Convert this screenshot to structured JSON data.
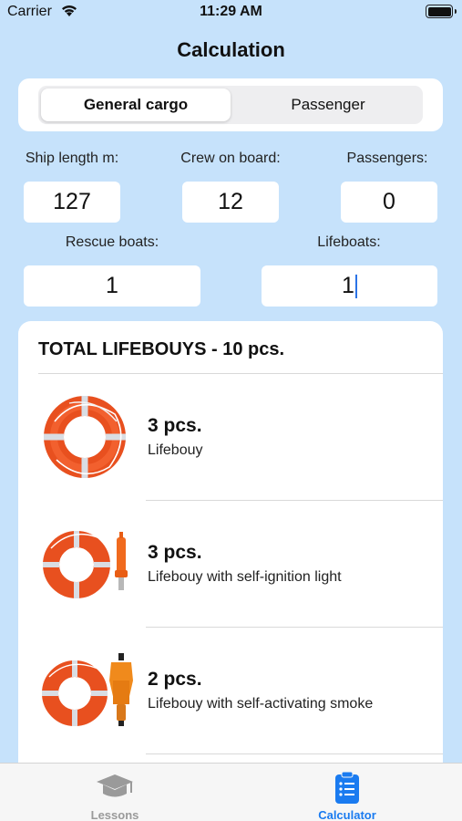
{
  "status_bar": {
    "carrier": "Carrier",
    "time": "11:29 AM"
  },
  "title": "Calculation",
  "segments": [
    {
      "label": "General cargo",
      "selected": true
    },
    {
      "label": "Passenger",
      "selected": false
    }
  ],
  "fields": {
    "ship_length": {
      "label": "Ship length m:",
      "value": "127"
    },
    "crew": {
      "label": "Crew on board:",
      "value": "12"
    },
    "passengers": {
      "label": "Passengers:",
      "value": "0"
    },
    "rescue_boats": {
      "label": "Rescue boats:",
      "value": "1"
    },
    "lifeboats": {
      "label": "Lifeboats:",
      "value": "1"
    }
  },
  "results": {
    "title": "TOTAL LIFEBOUYS - 10 pcs.",
    "items": [
      {
        "qty": "3 pcs.",
        "desc": "Lifebouy",
        "icon": "lifebuoy-icon"
      },
      {
        "qty": "3 pcs.",
        "desc": "Lifebouy with self-ignition light",
        "icon": "lifebuoy-light-icon"
      },
      {
        "qty": "2 pcs.",
        "desc": "Lifebouy with self-activating smoke",
        "icon": "lifebuoy-smoke-icon"
      }
    ]
  },
  "tabs": [
    {
      "label": "Lessons",
      "icon": "graduation-cap-icon",
      "active": false
    },
    {
      "label": "Calculator",
      "icon": "clipboard-list-icon",
      "active": true
    }
  ],
  "colors": {
    "background": "#c6e2fb",
    "accent": "#1a7bf0",
    "buoy_orange": "#ef5a23"
  }
}
